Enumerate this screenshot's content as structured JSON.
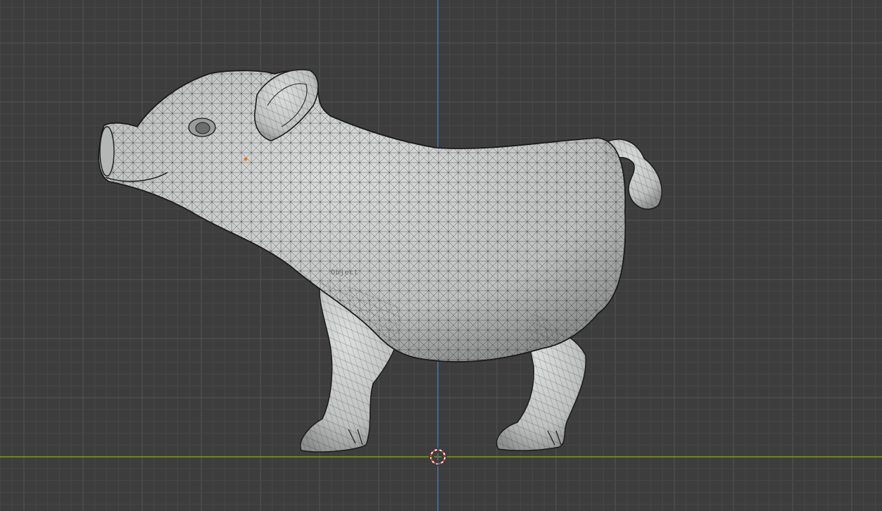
{
  "viewport": {
    "background": "#3d3d3d",
    "grid_minor_color": "#474747",
    "grid_major_color": "#555555",
    "x_axis_color": "#7f9a2a",
    "z_axis_color": "#4a72b0",
    "cursor_icon": "3d-cursor-icon",
    "origin_icon": "object-origin-icon"
  },
  "model": {
    "name": "pig-mesh",
    "object_label": "Object",
    "shading": "solid-wireframe",
    "fill_color": "#c9cbcb",
    "wire_color": "#1a1a1a"
  }
}
